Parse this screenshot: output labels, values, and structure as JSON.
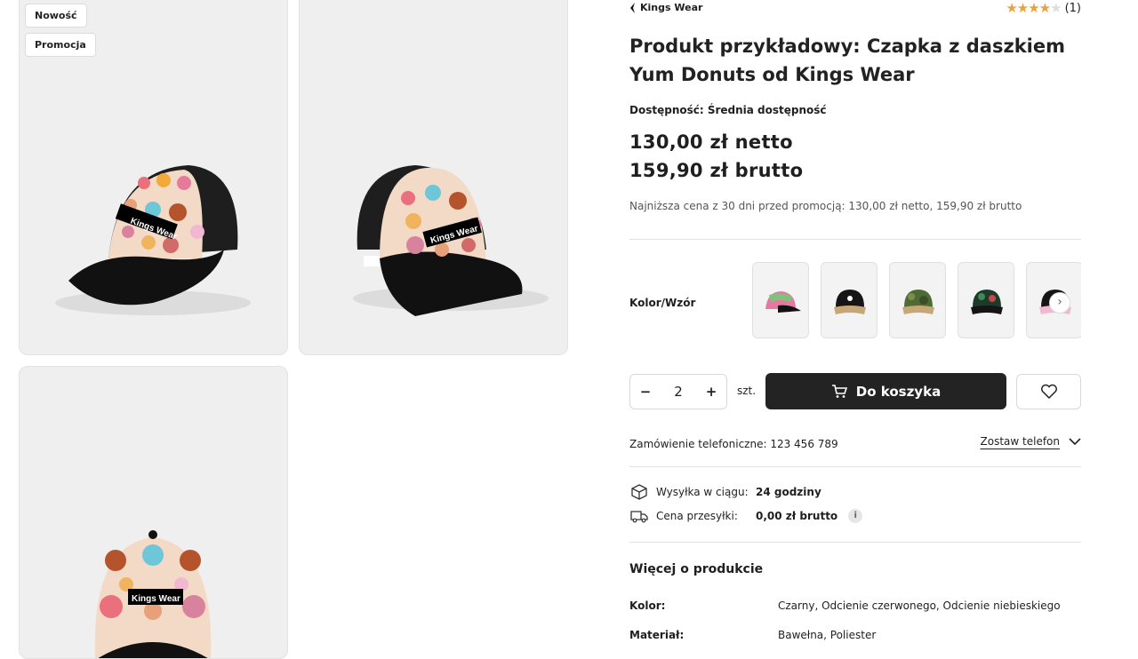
{
  "badges": [
    "Nowość",
    "Promocja"
  ],
  "cap_text": "Kings Wear",
  "brand": {
    "name": "Kings Wear"
  },
  "rating": {
    "stars": 4.5,
    "max": 5,
    "count": "(1)"
  },
  "product": {
    "title": "Produkt przykładowy: Czapka z daszkiem Yum Donuts od Kings Wear",
    "availability": "Dostępność: Średnia dostępność",
    "price_net": "130,00 zł netto",
    "price_gross": "159,90 zł brutto",
    "lowest_price": "Najniższa cena z 30 dni przed promocją: 130,00 zł netto, 159,90 zł brutto"
  },
  "variants": {
    "label": "Kolor/Wzór"
  },
  "purchase": {
    "quantity": "2",
    "minus": "−",
    "plus": "+",
    "unit": "szt.",
    "add_to_cart": "Do koszyka"
  },
  "phone": {
    "text": "Zamówienie telefoniczne: 123 456 789",
    "leave_phone": "Zostaw telefon"
  },
  "shipping": {
    "time_label": "Wysyłka w ciągu:",
    "time_value": "24 godziny",
    "cost_label": "Cena przesyłki:",
    "cost_value": "0,00 zł brutto",
    "info_icon": "i"
  },
  "more": {
    "heading": "Więcej o produkcie",
    "attributes": [
      {
        "name": "Kolor:",
        "value": "Czarny, Odcienie czerwonego, Odcienie niebieskiego"
      },
      {
        "name": "Materiał:",
        "value": "Bawełna, Poliester"
      }
    ]
  },
  "colors": {
    "dark": "#232323",
    "star": "#e8a43a",
    "cap_front": "#f2d9c4"
  }
}
